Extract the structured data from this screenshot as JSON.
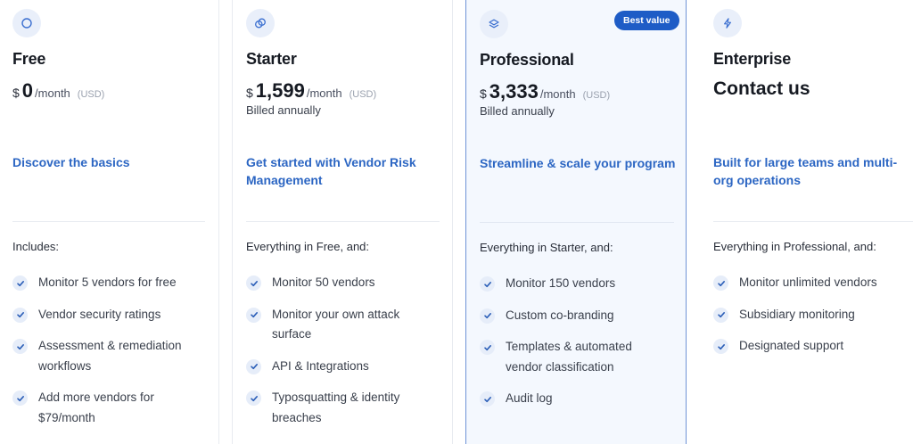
{
  "colors": {
    "accent": "#2c66c3",
    "badge": "#1e5cc6",
    "featured_border": "#6f93d6",
    "featured_bg": "#f4f8fe"
  },
  "plans": [
    {
      "icon": "circle-icon",
      "name": "Free",
      "currency": "$",
      "amount": "0",
      "per": "/month",
      "usd": "(USD)",
      "billed": "",
      "tagline": "Discover the basics",
      "includes": "Includes:",
      "features": [
        "Monitor 5 vendors for free",
        "Vendor security ratings",
        "Assessment & remediation workflows",
        "Add more vendors for $79/month"
      ]
    },
    {
      "icon": "overlapping-circles-icon",
      "name": "Starter",
      "currency": "$",
      "amount": "1,599",
      "per": "/month",
      "usd": "(USD)",
      "billed": "Billed annually",
      "tagline": "Get started with Vendor Risk Management",
      "includes": "Everything in Free, and:",
      "features": [
        "Monitor 50 vendors",
        "Monitor your own attack surface",
        "API & Integrations",
        "Typosquatting & identity breaches"
      ]
    },
    {
      "icon": "layers-icon",
      "name": "Professional",
      "badge": "Best value",
      "currency": "$",
      "amount": "3,333",
      "per": "/month",
      "usd": "(USD)",
      "billed": "Billed annually",
      "tagline": "Streamline & scale your program",
      "includes": "Everything in Starter, and:",
      "features": [
        "Monitor 150 vendors",
        "Custom co-branding",
        "Templates & automated vendor classification",
        "Audit log"
      ]
    },
    {
      "icon": "lightning-icon",
      "name": "Enterprise",
      "contact": "Contact us",
      "tagline": "Built for large teams and multi-org operations",
      "includes": "Everything in Professional, and:",
      "features": [
        "Monitor unlimited vendors",
        "Subsidiary monitoring",
        "Designated support"
      ]
    }
  ]
}
